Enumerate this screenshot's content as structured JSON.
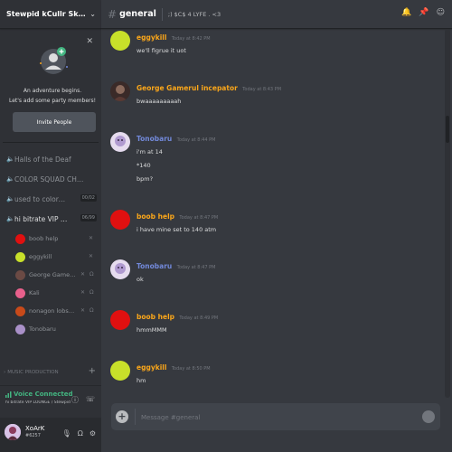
{
  "guild": {
    "name": "Stewpid kCullr Skwad [CSR..."
  },
  "invite": {
    "line1": "An adventure begins.",
    "line2": "Let's add some party members!",
    "button": "Invite People"
  },
  "voice_channels": [
    {
      "name": "Halls of the Deaf",
      "limit": ""
    },
    {
      "name": "COLOR SQUAD CHAT ST...",
      "limit": ""
    },
    {
      "name": "used to colormans p...",
      "limit": "00/02"
    },
    {
      "name": "hi bitrate VIP LOUN...",
      "limit": "06/99"
    }
  ],
  "voice_users": [
    {
      "name": "boob help",
      "color": "#e01010"
    },
    {
      "name": "eggykill",
      "color": "#c8e02a"
    },
    {
      "name": "George Gamerul i...",
      "color": "#6b4a44"
    },
    {
      "name": "Kali",
      "color": "#e8608c"
    },
    {
      "name": "nonagon lobster p...",
      "color": "#c84a1a"
    },
    {
      "name": "Tonobaru",
      "color": "#a990c8"
    }
  ],
  "category": {
    "name": "MUSIC PRODUCTION"
  },
  "voice_connected": {
    "status": "Voice Connected",
    "channel": "hi bitrate VIP LOUNGE / Stewpid ..."
  },
  "user": {
    "name": "XoArK",
    "tag": "#6257"
  },
  "channel": {
    "name": "general",
    "topic": ";) $C$ 4 LYFE . <3"
  },
  "messages": [
    {
      "author": "eggykill",
      "color": "#faa61a",
      "avatar": "#c8e02a",
      "time": "Today at 8:42 PM",
      "lines": [
        "we'll figrue it uot"
      ]
    },
    {
      "author": "George Gamerul incepator",
      "color": "#faa61a",
      "avatar": "#6b4a44",
      "time": "Today at 8:43 PM",
      "lines": [
        "bwaaaaaaaaah"
      ]
    },
    {
      "author": "Tonobaru",
      "color": "#7289da",
      "avatar": "#a990c8",
      "time": "Today at 8:44 PM",
      "lines": [
        "i'm at 14",
        "*140",
        "bpm?"
      ]
    },
    {
      "author": "boob help",
      "color": "#faa61a",
      "avatar": "#e01010",
      "time": "Today at 8:47 PM",
      "lines": [
        "i have mine set to 140 atm"
      ]
    },
    {
      "author": "Tonobaru",
      "color": "#7289da",
      "avatar": "#a990c8",
      "time": "Today at 8:47 PM",
      "lines": [
        "ok"
      ]
    },
    {
      "author": "boob help",
      "color": "#faa61a",
      "avatar": "#e01010",
      "time": "Today at 8:49 PM",
      "lines": [
        "hmmMMM"
      ]
    },
    {
      "author": "eggykill",
      "color": "#faa61a",
      "avatar": "#c8e02a",
      "time": "Today at 8:50 PM",
      "lines": [
        "hm"
      ]
    }
  ],
  "composer": {
    "placeholder": "Message #general"
  },
  "colors": {
    "bg_main": "#36393f",
    "bg_sidebar": "#2f3136",
    "bg_user_panel": "#292b2f",
    "voice_green": "#43b581",
    "mention_blue": "#7289da",
    "role_orange": "#faa61a"
  }
}
